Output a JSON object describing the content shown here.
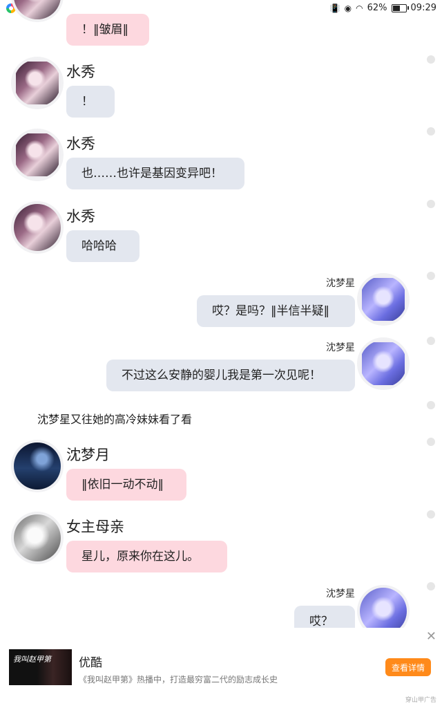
{
  "status": {
    "battery": "62%",
    "time": "09:29"
  },
  "chat": [
    {
      "type": "other",
      "name": "",
      "text": "！‖皱眉‖",
      "style": "pink"
    },
    {
      "type": "other",
      "name": "水秀",
      "text": "！",
      "style": "grey"
    },
    {
      "type": "other",
      "name": "水秀",
      "text": "也……也许是基因变异吧！",
      "style": "grey"
    },
    {
      "type": "other",
      "name": "水秀",
      "text": "哈哈哈",
      "style": "grey"
    },
    {
      "type": "self",
      "name": "沈梦星",
      "text": "哎？是吗？‖半信半疑‖",
      "style": "grey"
    },
    {
      "type": "self",
      "name": "沈梦星",
      "text": "不过这么安静的婴儿我是第一次见呢！",
      "style": "grey"
    },
    {
      "type": "narration",
      "text": "沈梦星又往她的高冷妹妹看了看"
    },
    {
      "type": "other",
      "name": "沈梦月",
      "text": "‖依旧一动不动‖",
      "style": "pink"
    },
    {
      "type": "other",
      "name": "女主母亲",
      "text": "星儿，原来你在这儿。",
      "style": "pink"
    },
    {
      "type": "self",
      "name": "沈梦星",
      "text": "哎？",
      "style": "grey"
    }
  ],
  "ad": {
    "brand": "优酷",
    "desc": "《我叫赵甲第》热播中，打造最穷富二代的励志成长史",
    "button": "查看详情",
    "source": "穿山甲广告",
    "poster_title": "我叫赵甲第"
  }
}
